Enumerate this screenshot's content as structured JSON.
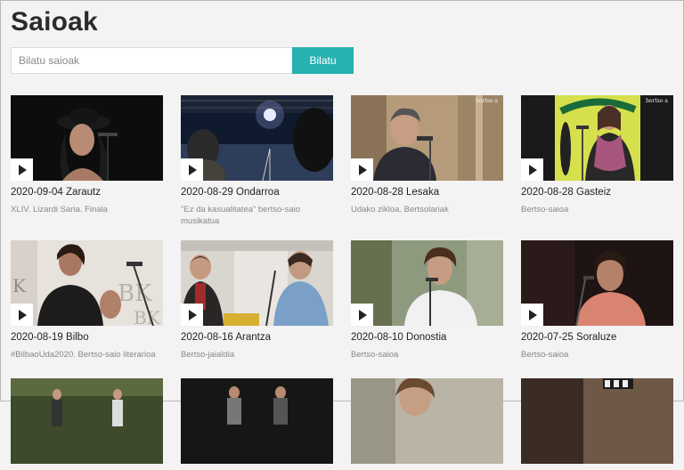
{
  "page": {
    "title": "Saioak"
  },
  "search": {
    "placeholder": "Bilatu saioak",
    "value": "",
    "button_label": "Bilatu"
  },
  "cards": [
    {
      "title": "2020-09-04 Zarautz",
      "subtitle": "XLIV. Lizardi Saria. Finala",
      "watermark": ""
    },
    {
      "title": "2020-08-29 Ondarroa",
      "subtitle": "\"Ez da kasualitatea\" bertso-saio musikatua",
      "watermark": ""
    },
    {
      "title": "2020-08-28 Lesaka",
      "subtitle": "Udako zikloa. Bertsolariak",
      "watermark": "bertso a"
    },
    {
      "title": "2020-08-28 Gasteiz",
      "subtitle": "Bertso-saioa",
      "watermark": "bertso a"
    },
    {
      "title": "2020-08-19 Bilbo",
      "subtitle": "#BilbaoUda2020. Bertso-saio literarioa",
      "watermark": ""
    },
    {
      "title": "2020-08-16 Arantza",
      "subtitle": "Bertso-jaialdia",
      "watermark": ""
    },
    {
      "title": "2020-08-10 Donostia",
      "subtitle": "Bertso-saioa",
      "watermark": ""
    },
    {
      "title": "2020-07-25 Soraluze",
      "subtitle": "Bertso-saioa",
      "watermark": ""
    },
    {
      "title": "",
      "subtitle": "",
      "watermark": ""
    },
    {
      "title": "",
      "subtitle": "",
      "watermark": ""
    },
    {
      "title": "",
      "subtitle": "",
      "watermark": ""
    },
    {
      "title": "",
      "subtitle": "",
      "watermark": ""
    }
  ]
}
